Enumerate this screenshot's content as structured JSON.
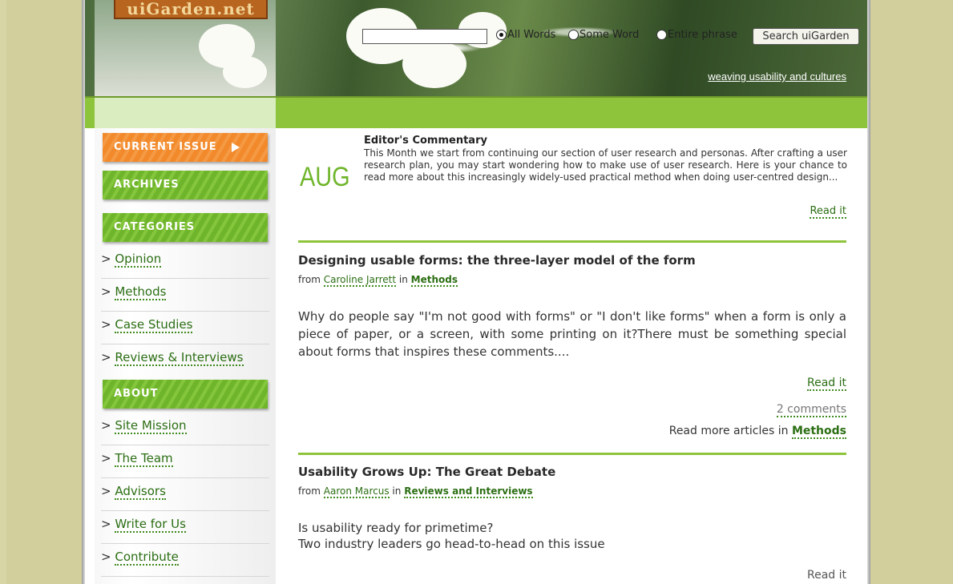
{
  "header": {
    "logo_text": "uiGarden.net",
    "tagline": "weaving usability and cultures"
  },
  "search": {
    "input_value": "",
    "options": [
      "All Words",
      "Some Word",
      "Entire phrase"
    ],
    "selected": "All Words",
    "button_label": "Search uiGarden"
  },
  "sidebar": {
    "current_issue": "CURRENT ISSUE",
    "archives": "ARCHIVES",
    "categories": "CATEGORIES",
    "category_items": [
      "Opinion",
      "Methods",
      "Case Studies",
      "Reviews & Interviews"
    ],
    "about": "ABOUT",
    "about_items": [
      "Site Mission",
      "The Team",
      "Advisors",
      "Write for Us",
      "Contribute"
    ],
    "prefix": ">"
  },
  "editor": {
    "month": "AUG",
    "title": "Editor's Commentary",
    "text": "This Month we start from continuing our section of user research and personas. After crafting a user research plan, you may start wondering how to make use of user research. Here is your chance to read more about this increasingly widely-used practical method when doing user-centred design...",
    "read_it": "Read it"
  },
  "articles": [
    {
      "title": "Designing usable forms: the three-layer model of the form",
      "from": "from",
      "author": "Caroline Jarrett",
      "in": "in",
      "category": "Methods",
      "text": "Why do people say \"I'm not good with forms\" or \"I don't like forms\" when a form is only a piece of paper, or a screen, with some printing on it?There must be something special about forms that inspires these comments....",
      "read_it": "Read it",
      "comments": "2 comments",
      "more_prefix": "Read more articles in",
      "more_category": "Methods"
    },
    {
      "title": "Usability Grows Up: The Great Debate",
      "from": "from",
      "author": "Aaron Marcus",
      "in": "in",
      "category": "Reviews and Interviews",
      "text_line1": "Is usability ready for primetime?",
      "text_line2": "Two industry leaders go head-to-head on this issue",
      "read_it": "Read it"
    }
  ]
}
